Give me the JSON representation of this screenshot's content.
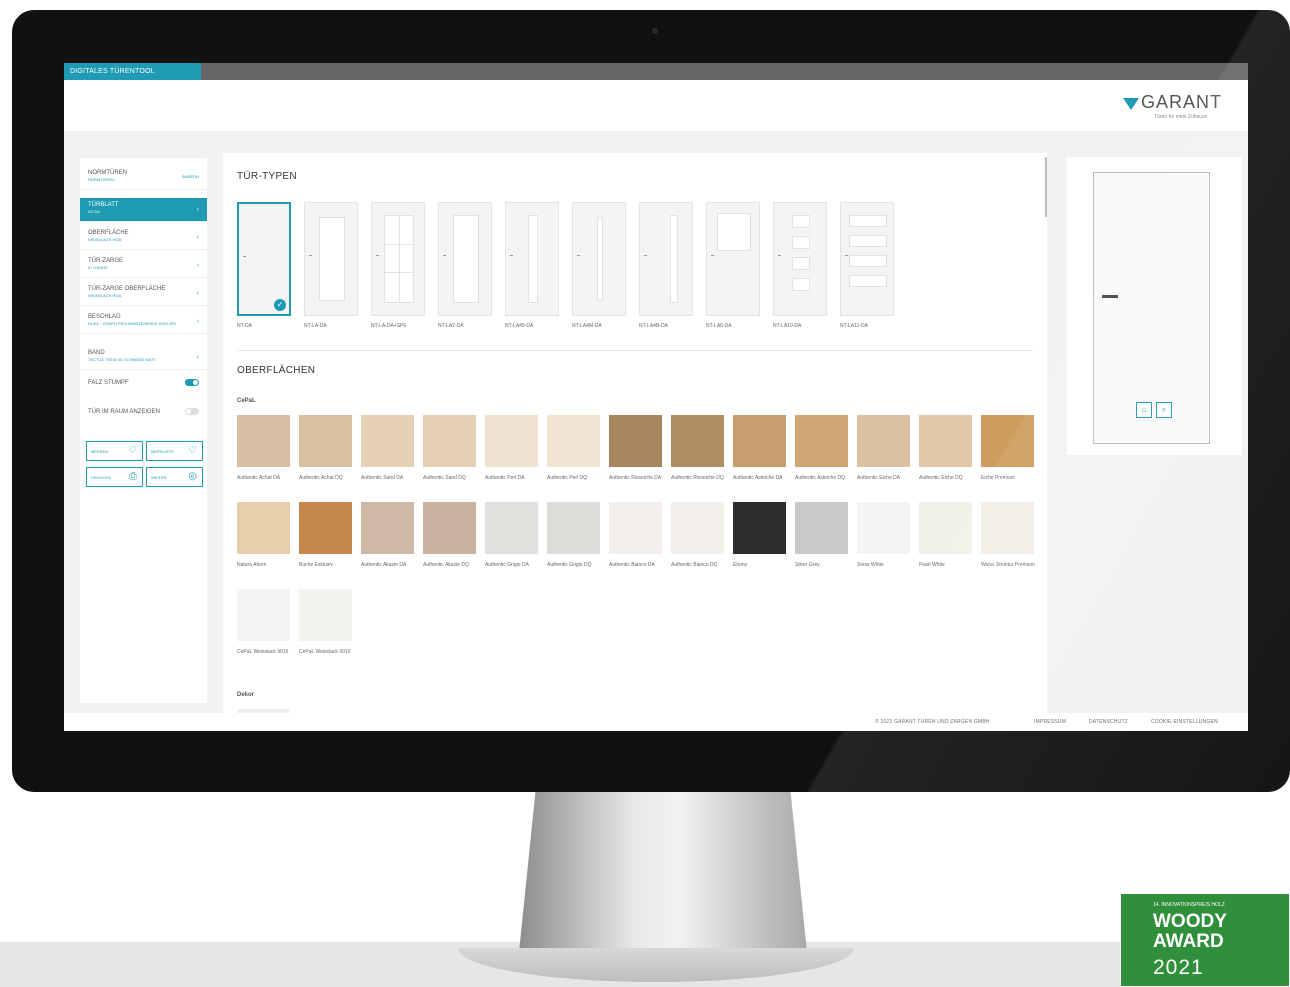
{
  "app": {
    "tab": "DIGITALES TÜRENTOOL",
    "brand": "GARANT",
    "brand_sub": "Türen für mein Zuhause"
  },
  "sidebar": {
    "items": [
      {
        "title": "NORMTÜREN",
        "sub": "NORMTÜREN",
        "right": "ÄNDERN"
      },
      {
        "title": "TÜRBLATT",
        "sub": "NT-DA"
      },
      {
        "title": "OBERFLÄCHE",
        "sub": "WEISSLACK 9016"
      },
      {
        "title": "TÜR-ZARGE",
        "sub": "57 GRADE"
      },
      {
        "title": "TÜR-ZARGE OBERFLÄCHE",
        "sub": "WEISSLACK 9016"
      },
      {
        "title": "BESCHLAG",
        "sub": "DUKE · GRAPH PSCHWARZE/WINKE KÜHLSIS"
      },
      {
        "title": "BAND",
        "sub": "TECTUS TE540 3D SCHWARZ MATT"
      }
    ],
    "toggles": [
      {
        "label": "FALZ STUMPF",
        "on": true
      },
      {
        "label": "TÜR IM RAUM ANZEIGEN",
        "on": false
      }
    ],
    "actions": [
      {
        "label": "MERKEN",
        "icon": "♡"
      },
      {
        "label": "MERKLISTE",
        "icon": "♡"
      },
      {
        "label": "DRUCKEN",
        "icon": "⎙"
      },
      {
        "label": "WEITER",
        "icon": "◎"
      }
    ]
  },
  "main": {
    "door_types_title": "TÜR-TYPEN",
    "door_types": [
      "NT-DA",
      "NT-LA-DA",
      "NT-LA-DA+SP6",
      "NT-LA2-DA",
      "NT-LA45-DA",
      "NT-LA4M-DA",
      "NT-LA4B-DA",
      "NT-LA6-DA",
      "NT-LA10-DA",
      "NT-LA11-DA"
    ],
    "surfaces_title": "OBERFLÄCHEN",
    "cepal_title": "CePaL",
    "swatches": [
      {
        "name": "Authentic Achat DA",
        "color": "#d7bea5"
      },
      {
        "name": "Authentic Achat DQ",
        "color": "#d9c0a3"
      },
      {
        "name": "Authentic Sand DA",
        "color": "#e5d2b6"
      },
      {
        "name": "Authentic Sand DQ",
        "color": "#e4d1b5"
      },
      {
        "name": "Authentic Perl DA",
        "color": "#f0e2d2"
      },
      {
        "name": "Authentic Perl DQ",
        "color": "#f1e4d4"
      },
      {
        "name": "Authentic Risseiche DA",
        "color": "#a6855f"
      },
      {
        "name": "Authentic Risseiche DQ",
        "color": "#b18e62"
      },
      {
        "name": "Authentic Asteiche DA",
        "color": "#c69e6f"
      },
      {
        "name": "Authentic Asteiche DQ",
        "color": "#cfa572"
      },
      {
        "name": "Authentic Eiche DA",
        "color": "#dcc1a1"
      },
      {
        "name": "Authentic Eiche DQ",
        "color": "#e1c7a7"
      },
      {
        "name": "Eiche Premium",
        "color": "#cf9c5d"
      },
      {
        "name": "Natura Ahorn",
        "color": "#e6cfa9"
      },
      {
        "name": "Buche Exklusiv",
        "color": "#c6884a"
      },
      {
        "name": "Authentic Akazie DA",
        "color": "#cdb9a5"
      },
      {
        "name": "Authentic Akazie DQ",
        "color": "#c9b2a0"
      },
      {
        "name": "Authentic Grigio DA",
        "color": "#e0e0dc"
      },
      {
        "name": "Authentic Grigio DQ",
        "color": "#dcdcd8"
      },
      {
        "name": "Authentic Bianco DA",
        "color": "#f3f0ec"
      },
      {
        "name": "Authentic Bianco DQ",
        "color": "#f2efea"
      },
      {
        "name": "Ebony",
        "color": "#2d2d2d"
      },
      {
        "name": "Silver Grey",
        "color": "#c7c9ca"
      },
      {
        "name": "Snow White",
        "color": "#f4f4f2"
      },
      {
        "name": "Pearl White",
        "color": "#f1f0e8"
      },
      {
        "name": "Weiss Struktur Premium",
        "color": "#f1efe6"
      },
      {
        "name": "CePaL Weisslack 9016",
        "color": "#f3f3f3"
      },
      {
        "name": "CePaL Weisslack 9010",
        "color": "#f3f2ee"
      }
    ],
    "dekor_title": "Dekor"
  },
  "preview": {
    "btn1": "⌂",
    "btn2": "⌕"
  },
  "footer": {
    "copyright": "© 2023 GARANT TÜREN UND ZARGEN GMBH",
    "links": [
      "IMPRESSUM",
      "DATENSCHUTZ",
      "COOKIE-EINSTELLUNGEN"
    ]
  },
  "award": {
    "small": "14. INNOVATIONSPREIS HOLZ",
    "line1": "WOODY",
    "line2": "AWARD",
    "year": "2021"
  },
  "colors": {
    "accent": "#1e9bb3",
    "award_green": "#2f8f3a"
  }
}
